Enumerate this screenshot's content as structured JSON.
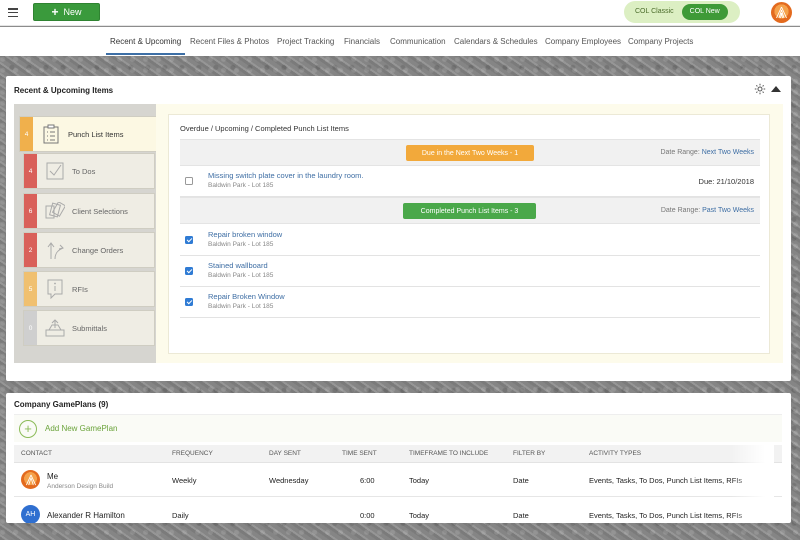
{
  "topbar": {
    "new_label": "New",
    "toggle": {
      "classic": "COL Classic",
      "new": "COL New",
      "active": "new"
    }
  },
  "nav": {
    "items": [
      "Recent & Upcoming",
      "Recent Files & Photos",
      "Project Tracking",
      "Financials",
      "Communication",
      "Calendars & Schedules",
      "Company Employees",
      "Company Projects"
    ],
    "active_index": 0
  },
  "recent_panel": {
    "title": "Recent & Upcoming Items",
    "sidebar": [
      {
        "count": "4",
        "label": "Punch List Items",
        "color": "#f0b04c",
        "icon": "clipboard-icon",
        "active": true
      },
      {
        "count": "4",
        "label": "To Dos",
        "color": "#d9605a",
        "icon": "checkbox-icon",
        "active": false
      },
      {
        "count": "6",
        "label": "Client Selections",
        "color": "#d9605a",
        "icon": "swatches-icon",
        "active": false
      },
      {
        "count": "2",
        "label": "Change Orders",
        "color": "#d9605a",
        "icon": "change-arrows-icon",
        "active": false
      },
      {
        "count": "5",
        "label": "RFIs",
        "color": "#f0c070",
        "icon": "info-icon",
        "active": false
      },
      {
        "count": "0",
        "label": "Submittals",
        "color": "#cfcfcf",
        "icon": "submittal-tray-icon",
        "active": false
      }
    ],
    "content_title": "Overdue / Upcoming / Completed Punch List Items",
    "upcoming": {
      "pill": "Due in the Next Two Weeks - 1",
      "range_label": "Date Range:",
      "range_value": "Next Two Weeks",
      "items": [
        {
          "title": "Missing switch plate cover in the laundry room.",
          "sub": "Baldwin Park - Lot 185",
          "due": "Due: 21/10/2018",
          "checked": false
        }
      ]
    },
    "completed": {
      "pill": "Completed Punch List Items - 3",
      "range_label": "Date Range:",
      "range_value": "Past Two Weeks",
      "items": [
        {
          "title": "Repair broken window",
          "sub": "Baldwin Park - Lot 185",
          "checked": true
        },
        {
          "title": "Stained wallboard",
          "sub": "Baldwin Park - Lot 185",
          "checked": true
        },
        {
          "title": "Repair Broken Window",
          "sub": "Baldwin Park - Lot 185",
          "checked": true
        }
      ]
    }
  },
  "gameplans": {
    "title": "Company GamePlans (9)",
    "add_label": "Add New GamePlan",
    "columns": [
      "CONTACT",
      "FREQUENCY",
      "DAY SENT",
      "TIME SENT",
      "TIMEFRAME TO INCLUDE",
      "FILTER BY",
      "ACTIVITY TYPES"
    ],
    "rows": [
      {
        "avatar": "logo",
        "initials": "",
        "name": "Me",
        "sub": "Anderson Design Build",
        "frequency": "Weekly",
        "day": "Wednesday",
        "time": "6:00",
        "timeframe": "Today",
        "filter": "Date",
        "activity": "Events, Tasks, To Dos, Punch List Items, RFIs"
      },
      {
        "avatar": "initials",
        "initials": "AH",
        "name": "Alexander R Hamilton",
        "sub": "",
        "frequency": "Daily",
        "day": "",
        "time": "0:00",
        "timeframe": "Today",
        "filter": "Date",
        "activity": "Events, Tasks, To Dos, Punch List Items, RFIs"
      }
    ]
  },
  "colors": {
    "new_button": "#3a9a3c",
    "link": "#3e6ea4",
    "accent_underline": "#3d6fa6",
    "pill_orange": "#f2a93b",
    "pill_green": "#4aa84a",
    "checkbox_blue": "#2f7bd4",
    "avatar_ah": "#2f6fd0",
    "add_green": "#6aa33a"
  }
}
